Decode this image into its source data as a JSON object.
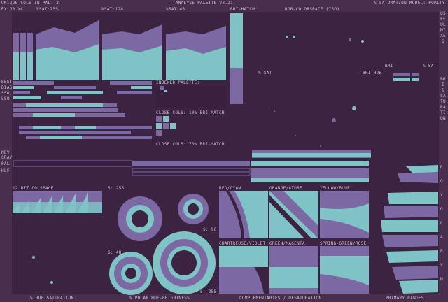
{
  "header": {
    "unique_cols": "UNIQUE COLS IN PAL: 3",
    "sub_labels": "RX GR XC",
    "xsat255": "%SAT:255",
    "xsat128": "%SAT:128",
    "xsat48": "%SAT:48",
    "title": "- ANALYSE PALETTE V2.21 -",
    "sat_model": "% SATURATION MODEL: PURITY",
    "bri_hatch": "BRI-HATCH",
    "rgb_colorspace": "RGB-COLORSPACE (ISO)"
  },
  "left_labels": {
    "best": "BEST",
    "bias": "BIAS",
    "sso": "SSO",
    "lso": "LSO",
    "nev": "NEV",
    "gray": "GRAY",
    "pal": "PAL",
    "hlf": "HLF"
  },
  "indexed": {
    "title": "INDEXED PALETTE:",
    "close10": "CLOSE COLS: 10% BRI-MATCH",
    "close70": "CLOSE COLS: 70% BRI-MATCH"
  },
  "rgb_space": {
    "xsat": "% SAT",
    "bri_hue": "BRI-HUE",
    "bri": "BRI",
    "xsat2": "% SAT"
  },
  "side_tabs": {
    "useful_mixes": "USEFUL MIXES",
    "bri_saturation": "BRI & SATURATION",
    "colors": [
      "R",
      "O",
      "Y",
      "G",
      "C",
      "A",
      "B",
      "V",
      "M"
    ]
  },
  "colspace": {
    "title": "12 BIT COLSPACE",
    "s255": "S: 255",
    "s96": "S: 96",
    "s48": "S: 48",
    "s255b": "S: 255"
  },
  "complementaries": {
    "red_cyan": "RED/CYAN",
    "orange_azure": "ORANGE/AZURE",
    "yellow_blue": "YELLOW/BLUE",
    "chartreuse_violet": "CHARTREUSE/VIOLET",
    "green_magenta": "GREEN/MAGENTA",
    "spring_rose": "SPRING-GREEN/ROSE"
  },
  "footer": {
    "hue_sat": "% HUE-SATURATION",
    "polar": "% POLAR HUE-BRIGHTNESS",
    "complementaries": "COMPLEMENTARIES / DESATURATION",
    "primary": "PRIMARY RANGES"
  },
  "colors": {
    "bg": "#4a2e4d",
    "panel": "#3d2342",
    "cyan": "#7fc3c7",
    "purple": "#7c69a4",
    "text": "#c9c0cf"
  }
}
